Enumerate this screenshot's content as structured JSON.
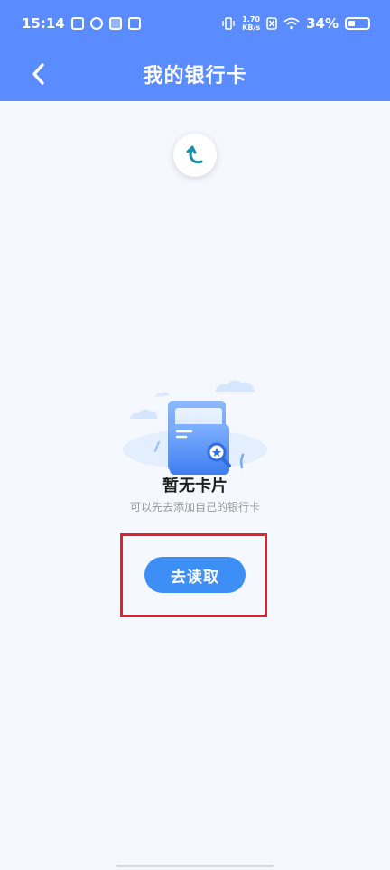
{
  "status_bar": {
    "time": "15:14",
    "net_speed_value": "1.70",
    "net_speed_unit": "KB/s",
    "battery_percent": "34%",
    "battery_level": 0.34
  },
  "header": {
    "title": "我的银行卡",
    "background_color": "#5b8cff"
  },
  "empty_state": {
    "title": "暂无卡片",
    "subtitle": "可以先去添加自己的银行卡"
  },
  "actions": {
    "read_button_label": "去读取",
    "button_color": "#3d8ff5",
    "highlight_color": "#e0202a"
  },
  "icons": {
    "back": "chevron-left-icon",
    "refresh": "refresh-icon",
    "illustration": "empty-folder-illustration"
  }
}
